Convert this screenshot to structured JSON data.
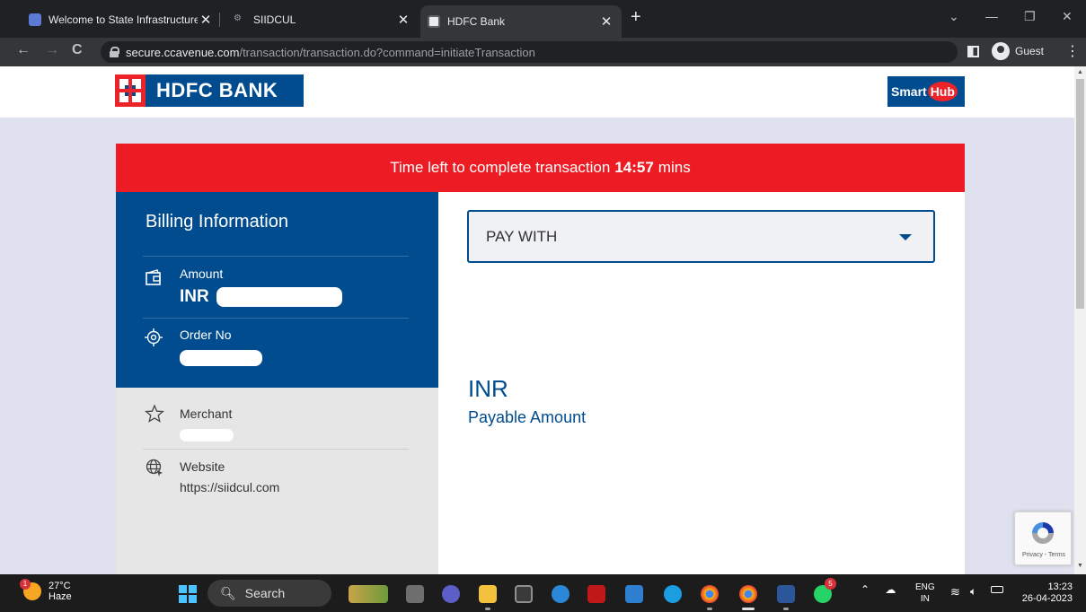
{
  "browser": {
    "tabs": [
      {
        "title": "Welcome to State Infrastructure I",
        "active": false
      },
      {
        "title": "SIIDCUL",
        "active": false
      },
      {
        "title": "HDFC Bank",
        "active": true
      }
    ],
    "new_tab": "+",
    "url_host": "secure.ccavenue.com",
    "url_path": "/transaction/transaction.do?command=initiateTransaction",
    "profile": "Guest"
  },
  "header": {
    "bank_name": "HDFC BANK",
    "smarthub_text": "Smart",
    "smarthub_hub": "Hub"
  },
  "timer": {
    "prefix": "Time left to complete transaction",
    "time": "14:57",
    "suffix": "mins"
  },
  "billing": {
    "title": "Billing Information",
    "amount_label": "Amount",
    "amount_currency": "INR",
    "order_label": "Order No",
    "merchant_label": "Merchant",
    "website_label": "Website",
    "website_value": "https://siidcul.com"
  },
  "payment": {
    "pay_with": "PAY WITH",
    "amount_currency": "INR",
    "payable_label": "Payable Amount"
  },
  "recaptcha": {
    "links": "Privacy - Terms"
  },
  "taskbar": {
    "weather_temp": "27°C",
    "weather_desc": "Haze",
    "weather_badge": "1",
    "search": "Search",
    "lang_top": "ENG",
    "lang_bottom": "IN",
    "time": "13:23",
    "date": "26-04-2023",
    "whatsapp_badge": "5"
  },
  "colors": {
    "hdfc_blue": "#004c8f",
    "hdfc_red": "#ed1c24"
  }
}
